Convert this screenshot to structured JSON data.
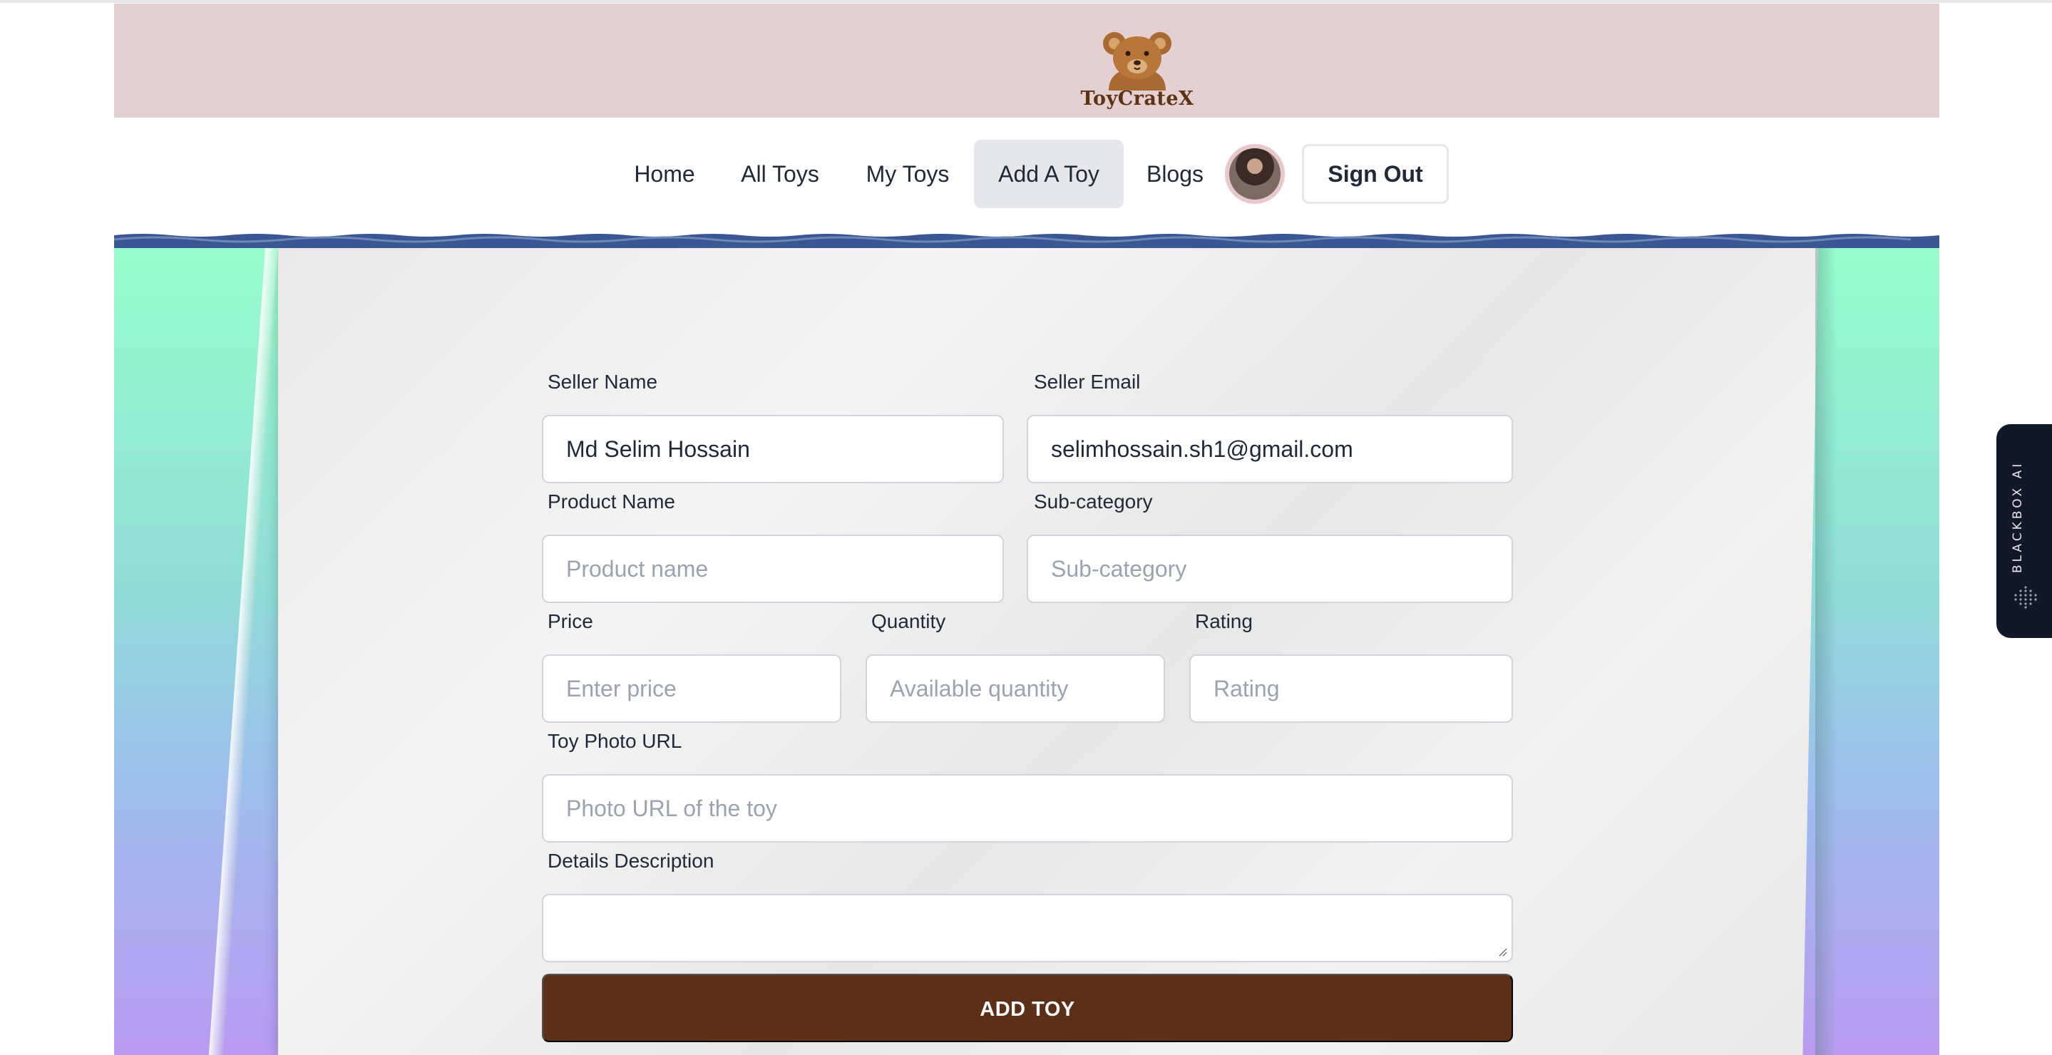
{
  "brand": {
    "name": "ToyCrateX"
  },
  "nav": {
    "items": [
      {
        "label": "Home"
      },
      {
        "label": "All Toys"
      },
      {
        "label": "My Toys"
      },
      {
        "label": "Add A Toy"
      },
      {
        "label": "Blogs"
      }
    ],
    "active": "Add A Toy",
    "signout_label": "Sign Out"
  },
  "form": {
    "seller_name": {
      "label": "Seller Name",
      "value": "Md Selim Hossain"
    },
    "seller_email": {
      "label": "Seller Email",
      "value": "selimhossain.sh1@gmail.com"
    },
    "product_name": {
      "label": "Product Name",
      "placeholder": "Product name"
    },
    "sub_category": {
      "label": "Sub-category",
      "placeholder": "Sub-category"
    },
    "price": {
      "label": "Price",
      "placeholder": "Enter price"
    },
    "quantity": {
      "label": "Quantity",
      "placeholder": "Available quantity"
    },
    "rating": {
      "label": "Rating",
      "placeholder": "Rating"
    },
    "photo_url": {
      "label": "Toy Photo URL",
      "placeholder": "Photo URL of the toy"
    },
    "description": {
      "label": "Details Description",
      "value": ""
    },
    "submit_label": "ADD TOY"
  },
  "blackbox": {
    "label": "BLACKBOX AI"
  },
  "colors": {
    "banner": "#e4d0d1",
    "submit": "#5c2f18",
    "wave": "#3b5793",
    "active_nav": "#e5e7eb"
  }
}
